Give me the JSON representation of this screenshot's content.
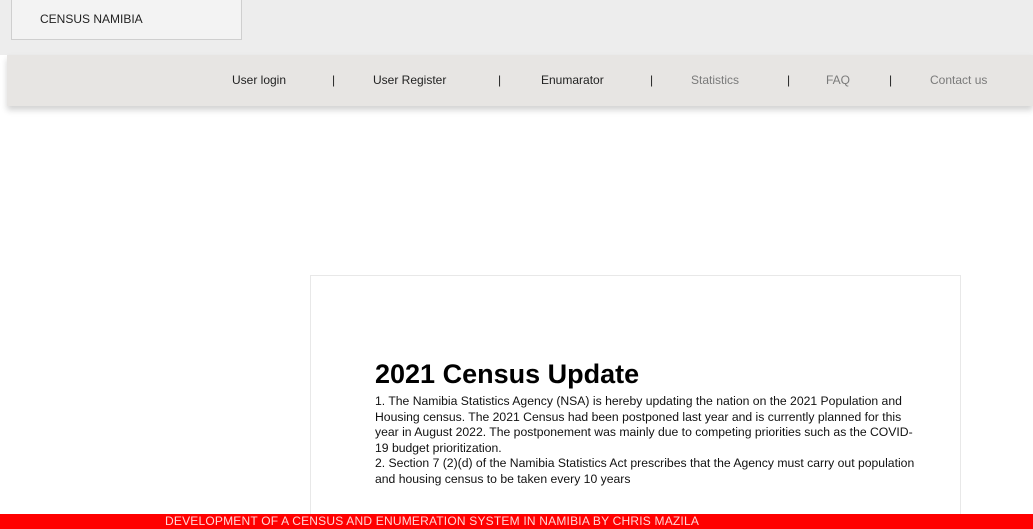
{
  "header": {
    "brand": "CENSUS NAMIBIA"
  },
  "nav": {
    "items": [
      {
        "label": "User login"
      },
      {
        "label": "User Register"
      },
      {
        "label": "Enumarator"
      },
      {
        "label": "Statistics"
      },
      {
        "label": "FAQ"
      },
      {
        "label": "Contact us"
      }
    ],
    "separator": "|"
  },
  "card": {
    "title": "2021 Census Update",
    "paragraphs": [
      "1. The Namibia Statistics Agency (NSA) is hereby updating the nation on the 2021 Population and Housing census. The 2021 Census had been postponed last year and is currently planned for this year in August 2022. The postponement was mainly due to competing priorities such as the COVID-19 budget prioritization.",
      "2. Section 7 (2)(d) of the Namibia Statistics Act prescribes that the Agency must carry out population and housing census to be taken every 10 years"
    ]
  },
  "footer": {
    "text": "DEVELOPMENT OF A CENSUS AND ENUMERATION SYSTEM IN NAMIBIA BY CHRIS MAZILA"
  }
}
